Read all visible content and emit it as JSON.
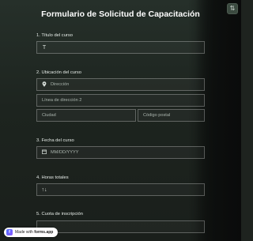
{
  "form": {
    "title": "Formulario de Solicitud de Capacitación",
    "corner_button_glyph": "⇅",
    "q1": {
      "label": "1.  Título del curso",
      "icon": "T"
    },
    "q2": {
      "label": "2.  Ubicación del curso",
      "address_placeholder": "Dirección",
      "address2_placeholder": "Línea de dirección 2",
      "city_placeholder": "Ciudad",
      "zip_placeholder": "Código postal"
    },
    "q3": {
      "label": "3.  Fecha del curso",
      "date_placeholder": "MM/DD/YYYY"
    },
    "q4": {
      "label": "4.  Horas totales",
      "icon": "↑↓"
    },
    "q5": {
      "label": "5.  Cuota de inscripción"
    }
  },
  "badge": {
    "prefix": "Made with",
    "brand": "forms.app"
  },
  "icons": {
    "text-field-icon": "T",
    "location-pin-icon": "⚲",
    "calendar-icon": "▦",
    "number-icon": "↑↓"
  }
}
